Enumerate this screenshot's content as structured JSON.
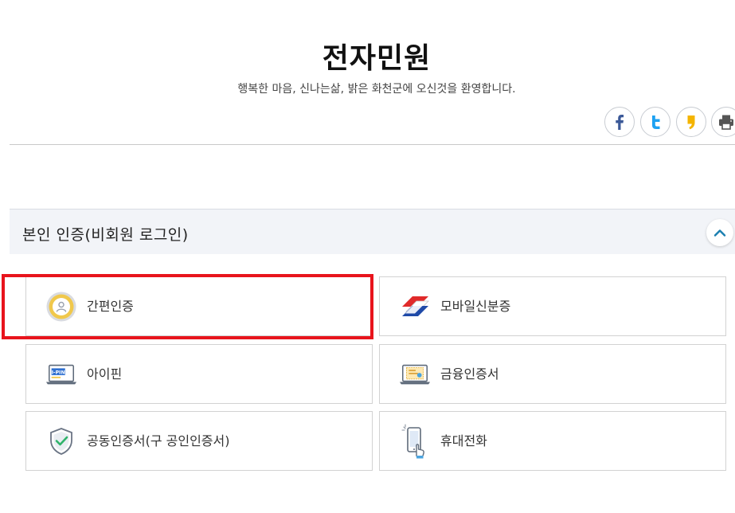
{
  "header": {
    "title": "전자민원",
    "subtitle": "행복한 마음, 신나는삶, 밝은 화천군에 오신것을 환영합니다."
  },
  "share": {
    "facebook_icon": "facebook-icon",
    "twitter_icon": "twitter-icon",
    "kakaostory_icon": "kakaostory-icon",
    "print_icon": "print-icon",
    "facebook_color": "#3b5998",
    "twitter_color": "#1da1f2",
    "kakaostory_color": "#f4b400"
  },
  "section": {
    "title": "본인 인증(비회원 로그인)",
    "toggle_icon": "chevron-up-icon",
    "toggle_color": "#1a7fb0"
  },
  "auth_methods": [
    {
      "label": "간편인증",
      "icon": "simple-auth-icon"
    },
    {
      "label": "모바일신분증",
      "icon": "mobile-id-icon"
    },
    {
      "label": "아이핀",
      "icon": "ipin-icon"
    },
    {
      "label": "금융인증서",
      "icon": "financial-certificate-icon"
    },
    {
      "label": "공동인증서(구 공인인증서)",
      "icon": "joint-certificate-icon"
    },
    {
      "label": "휴대전화",
      "icon": "mobile-phone-icon"
    }
  ],
  "highlight": {
    "color": "#e8141c",
    "target": "간편인증"
  }
}
